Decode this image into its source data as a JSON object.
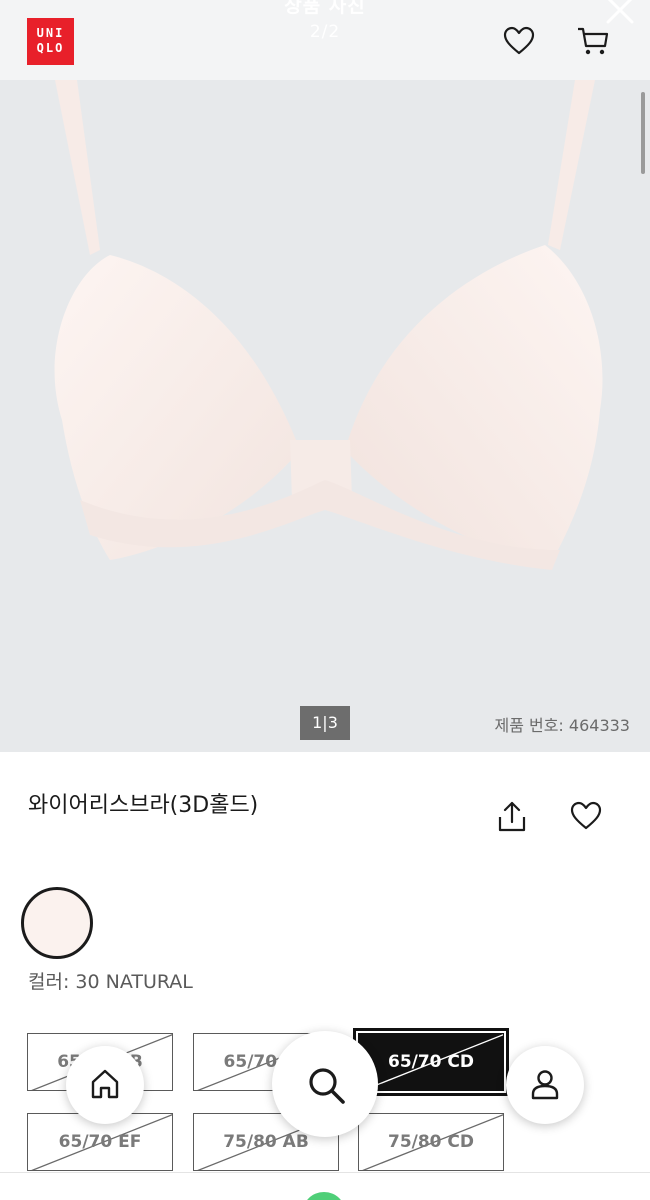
{
  "viewer": {
    "title": "상품 사진",
    "counter": "2/2"
  },
  "header": {
    "logo_lines": [
      "UNI",
      "QLO"
    ]
  },
  "gallery": {
    "pager": "1|3",
    "product_number": "제품 번호: 464333"
  },
  "product": {
    "title": "와이어리스브라(3D홀드)",
    "color_label": "컬러: 30 NATURAL",
    "swatch_color": "#fbf2ee"
  },
  "sizes": [
    {
      "label": "65/70 AB",
      "state": "unavailable"
    },
    {
      "label": "65/70 BC",
      "state": "unavailable"
    },
    {
      "label": "65/70 CD",
      "state": "selected"
    },
    {
      "label": "65/70 EF",
      "state": "unavailable"
    },
    {
      "label": "75/80 AB",
      "state": "unavailable"
    },
    {
      "label": "75/80 CD",
      "state": "unavailable"
    }
  ],
  "icons": [
    "close-icon",
    "heart-icon",
    "cart-icon",
    "share-icon",
    "home-icon",
    "search-icon",
    "user-icon"
  ],
  "colors": {
    "brand": "#e8202a",
    "selected": "#111111",
    "gallery_bg": "#e7e9eb"
  }
}
